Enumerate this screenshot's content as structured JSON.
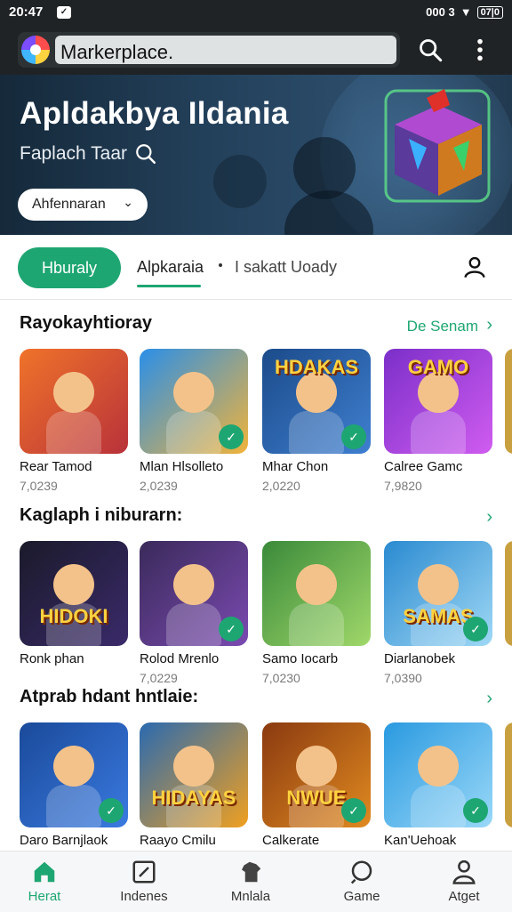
{
  "status_bar": {
    "time": "20:47",
    "right_text": "000 3",
    "battery": "07|0"
  },
  "top_bar": {
    "search_value": "Markerplace."
  },
  "hero": {
    "title": "Apldakbya Ildania",
    "subtitle": "Faplach Taar",
    "button_label": "Ahfennaran"
  },
  "tabs": {
    "active": "Hburaly",
    "second": "Alpkaraia",
    "third": "I sakatt Uoady"
  },
  "sections": [
    {
      "title": "Rayokayhtioray",
      "see_all": "De Senam",
      "cards": [
        {
          "name": "Rear Tamod",
          "meta": "7,0239",
          "palette": [
            "#f0732a",
            "#b8323a"
          ],
          "badge": ""
        },
        {
          "name": "Mlan Hlsolleto",
          "meta": "2,0239",
          "palette": [
            "#2a8fe8",
            "#f1b33a"
          ],
          "badge": "✓"
        },
        {
          "name": "Mhar Chon",
          "meta": "2,0220",
          "palette": [
            "#1b4b8a",
            "#3f7fd0"
          ],
          "badge": "✓",
          "logo": "HDAKAS"
        },
        {
          "name": "Calree Gamc",
          "meta": "7,9820",
          "palette": [
            "#7b2fc9",
            "#d05cf0"
          ],
          "badge": "",
          "logo": "GAMO"
        }
      ]
    },
    {
      "title": "Kaglaph i niburarn:",
      "see_all": "",
      "cards": [
        {
          "name": "Ronk phan",
          "meta": "",
          "palette": [
            "#1a1a2a",
            "#3a2a6a"
          ],
          "badge": "",
          "logo": "HIDOKI"
        },
        {
          "name": "Rolod Mrenlo",
          "meta": "7,0229",
          "palette": [
            "#3a2a5a",
            "#7a4ab0"
          ],
          "badge": "✓"
        },
        {
          "name": "Samo Iocarb",
          "meta": "7,0230",
          "palette": [
            "#3a8a3a",
            "#a0d86a"
          ],
          "badge": ""
        },
        {
          "name": "Diarlanobek",
          "meta": "7,0390",
          "palette": [
            "#2a8ad0",
            "#9fd8f5"
          ],
          "badge": "✓",
          "logo": "SAMAS"
        }
      ]
    },
    {
      "title": "Atprab hdant hntlaie:",
      "see_all": "",
      "cards": [
        {
          "name": "Daro Barnjlaok",
          "meta": "",
          "palette": [
            "#1a4a9a",
            "#3a7ae0"
          ],
          "badge": "✓"
        },
        {
          "name": "Raayo Cmilu",
          "meta": "",
          "palette": [
            "#2a6ab0",
            "#f0a020"
          ],
          "badge": "",
          "logo": "HIDAYAS"
        },
        {
          "name": "Calkerate",
          "meta": "",
          "palette": [
            "#8a3a10",
            "#e08a20"
          ],
          "badge": "✓",
          "logo": "NWUE"
        },
        {
          "name": "Kan'Uehoak",
          "meta": "",
          "palette": [
            "#2a9ae0",
            "#9ad8f8"
          ],
          "badge": "✓"
        }
      ]
    }
  ],
  "bottom_nav": [
    {
      "label": "Herat",
      "icon": "home-icon",
      "active": true
    },
    {
      "label": "Indenes",
      "icon": "checkbox-icon",
      "active": false
    },
    {
      "label": "Mnlala",
      "icon": "shirt-icon",
      "active": false
    },
    {
      "label": "Game",
      "icon": "search-icon",
      "active": false
    },
    {
      "label": "Atget",
      "icon": "person-icon",
      "active": false
    }
  ],
  "colors": {
    "accent": "#1ea672",
    "dark_bar": "#1f2326"
  }
}
